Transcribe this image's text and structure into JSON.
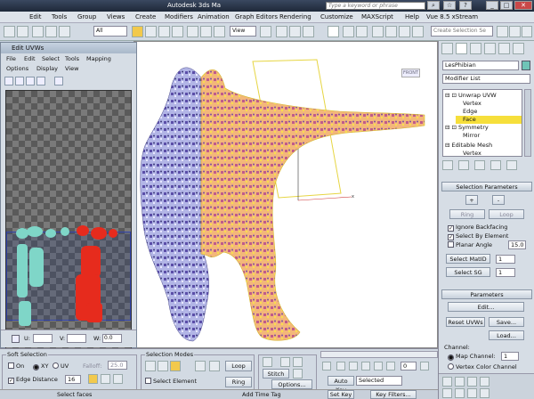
{
  "titlebar": {
    "title": "Autodesk 3ds Ma",
    "search_placeholder": "Type a keyword or phrase"
  },
  "menu": [
    "Edit",
    "Tools",
    "Group",
    "Views",
    "Create",
    "Modifiers",
    "Animation",
    "Graph Editors",
    "Rendering",
    "Customize",
    "MAXScript",
    "Help",
    "Vue 8.5 xStream"
  ],
  "toolbar": {
    "filter_dropdown": "All",
    "view_dropdown": "View",
    "selection_set_placeholder": "Create Selection Se"
  },
  "uv_editor": {
    "title": "Edit UVWs",
    "menu1": [
      "File",
      "Edit",
      "Select",
      "Tools",
      "Mapping"
    ],
    "menu2": [
      "Options",
      "Display",
      "View"
    ],
    "u_label": "U:",
    "v_label": "V:",
    "w_label": "W:",
    "w_value": "0.0"
  },
  "viewport": {
    "label": "FRONT",
    "axis_y": "y",
    "axis_x": "x"
  },
  "command_panel": {
    "object_name": "LesPhibian",
    "modifier_list": "Modifier List",
    "stack": [
      {
        "label": "Unwrap UVW",
        "indent": 0
      },
      {
        "label": "Vertex",
        "indent": 1
      },
      {
        "label": "Edge",
        "indent": 1
      },
      {
        "label": "Face",
        "indent": 1,
        "selected": true
      },
      {
        "label": "Symmetry",
        "indent": 0
      },
      {
        "label": "Mirror",
        "indent": 1
      },
      {
        "label": "Editable Mesh",
        "indent": 0
      },
      {
        "label": "Vertex",
        "indent": 1
      }
    ],
    "selection_params": {
      "title": "Selection Parameters",
      "plus": "+",
      "minus": "-",
      "ring": "Ring",
      "loop": "Loop",
      "ignore_backfacing": "Ignore Backfacing",
      "select_by_element": "Select By Element",
      "planar_angle": "Planar Angle",
      "planar_angle_value": "15.0",
      "select_matid": "Select MatID",
      "select_matid_value": "1",
      "select_sg": "Select SG",
      "select_sg_value": "1"
    },
    "parameters": {
      "title": "Parameters",
      "edit": "Edit...",
      "reset_uvws": "Reset UVWs",
      "save": "Save...",
      "load": "Load...",
      "channel": "Channel:",
      "map_channel": "Map Channel:",
      "map_channel_value": "1",
      "vertex_color_channel": "Vertex Color Channel"
    }
  },
  "bottom": {
    "soft_selection": "Soft Selection",
    "on": "On",
    "xy": "XY",
    "uv": "UV",
    "falloff": "Falloff:",
    "falloff_value": "25.0",
    "edge_distance": "Edge Distance",
    "edge_distance_value": "16",
    "selection_modes": "Selection Modes",
    "loop": "Loop",
    "ring": "Ring",
    "select_element": "Select Element",
    "stitch": "Stitch",
    "options": "Options...",
    "auto_key": "Auto Key",
    "set_key": "Set Key",
    "selected": "Selected",
    "key_filters": "Key Filters...",
    "frame": "0",
    "add_time_tag": "Add Time Tag",
    "status_left": "Select faces"
  }
}
